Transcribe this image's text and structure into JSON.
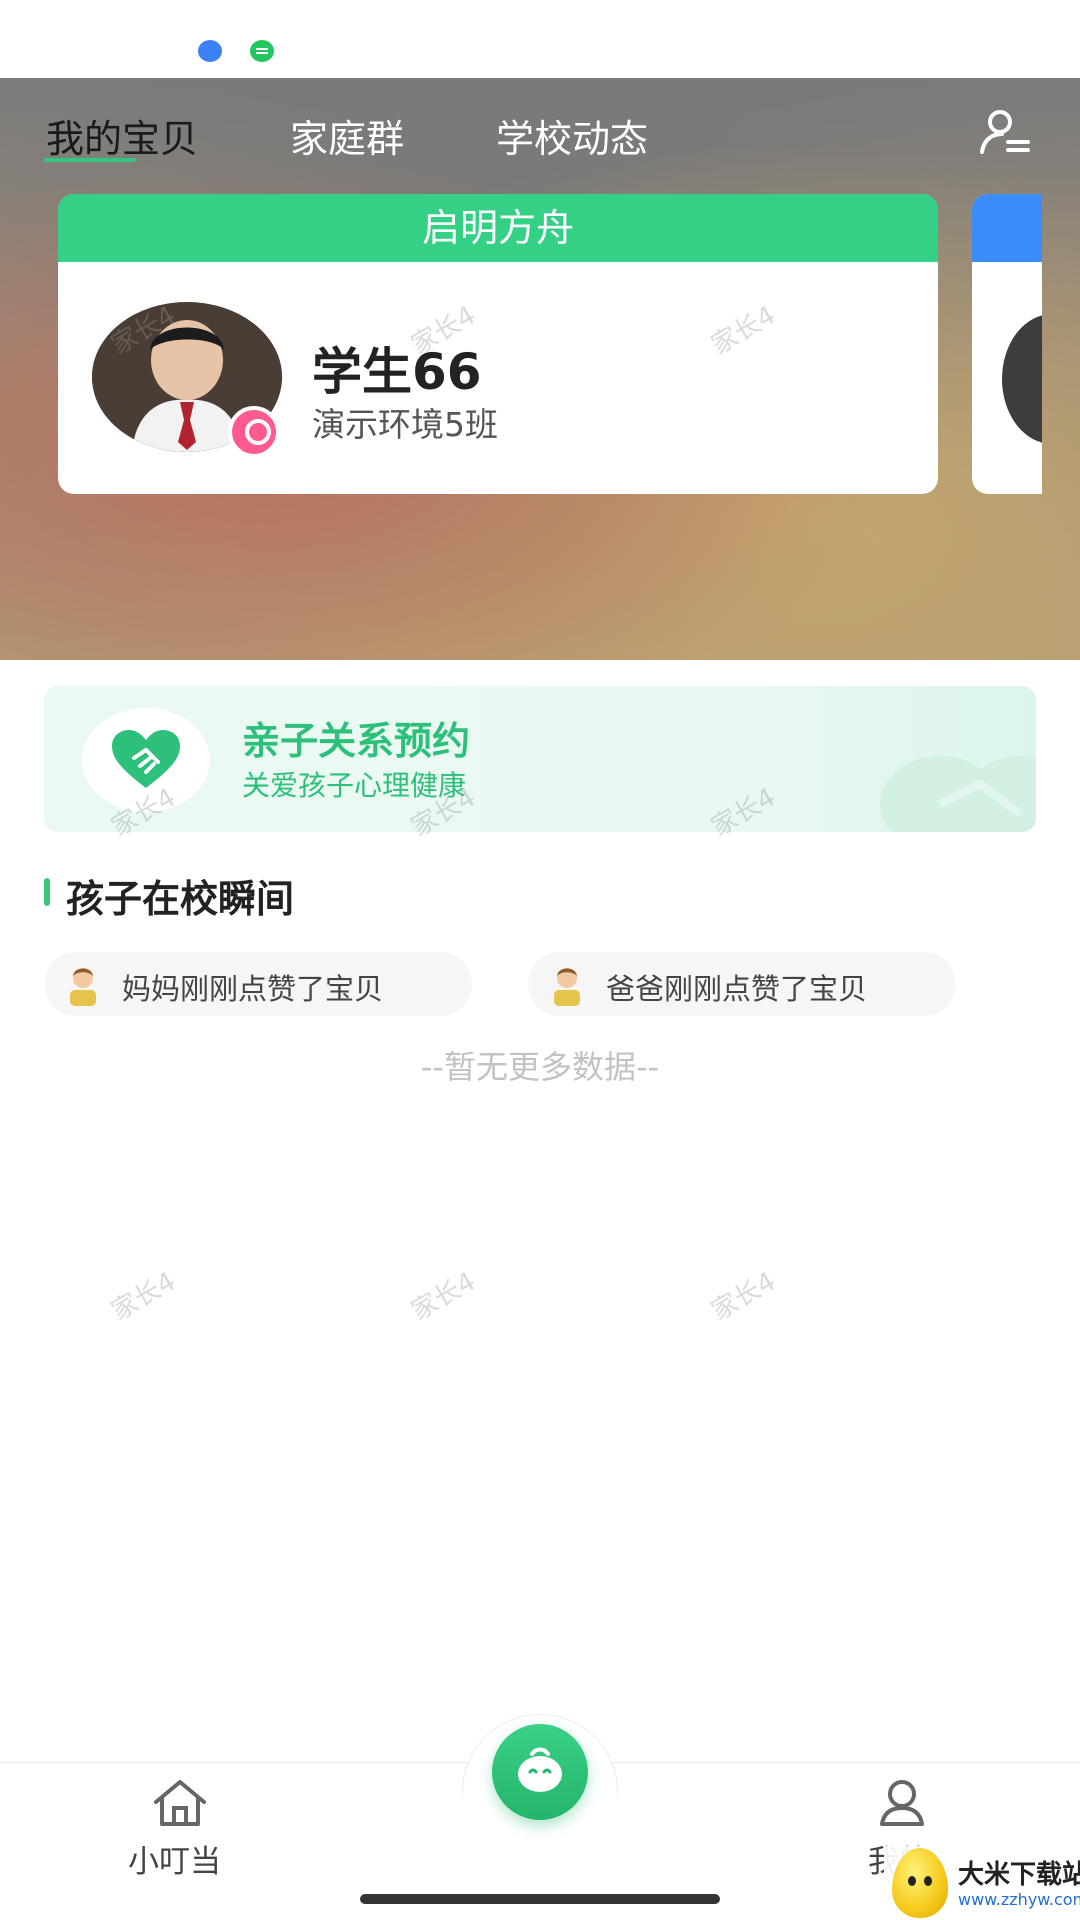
{
  "header": {
    "tabs": [
      {
        "label": "我的宝贝",
        "active": true
      },
      {
        "label": "家庭群",
        "active": false
      },
      {
        "label": "学校动态",
        "active": false
      }
    ],
    "right_icon": "user-list-icon"
  },
  "student_card": {
    "school": "启明方舟",
    "name": "学生66",
    "class": "演示环境5班",
    "header_color": "#34d086",
    "badge_color": "#ff5b8f"
  },
  "next_card": {
    "header_color": "#3b8cf6"
  },
  "banner": {
    "title": "亲子关系预约",
    "subtitle": "关爱孩子心理健康",
    "icon": "heart-handshake-icon",
    "accent": "#2cc07b"
  },
  "section": {
    "title": "孩子在校瞬间",
    "activities": [
      {
        "text": "妈妈刚刚点赞了宝贝",
        "icon": "parent-avatar-icon"
      },
      {
        "text": "爸爸刚刚点赞了宝贝",
        "icon": "parent-avatar-icon"
      }
    ],
    "no_more": "--暂无更多数据--"
  },
  "watermark": "家长4",
  "bottom_nav": {
    "home_label": "小叮当",
    "center_icon": "baby-face-icon",
    "me_label": "我的"
  },
  "logo": {
    "title": "大米下载站",
    "url": "www.zzhyw.com"
  }
}
